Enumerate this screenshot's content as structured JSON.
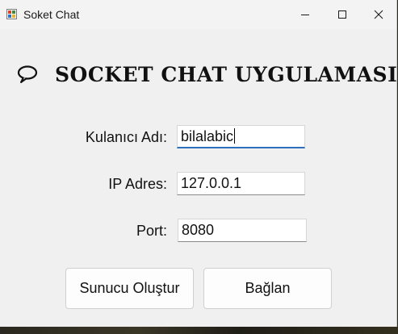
{
  "window": {
    "title": "Soket Chat"
  },
  "heading": {
    "text": "SOCKET CHAT UYGULAMASI",
    "icon": "speech-bubble-icon"
  },
  "form": {
    "username": {
      "label": "Kulanıcı Adı:",
      "value": "bilalabic"
    },
    "ip": {
      "label": "IP Adres:",
      "value": "127.0.0.1"
    },
    "port": {
      "label": "Port:",
      "value": "8080"
    }
  },
  "buttons": {
    "create_server": "Sunucu Oluştur",
    "connect": "Bağlan"
  },
  "colors": {
    "window_bg": "#f0f0f0",
    "focus_accent": "#2b6fbd"
  }
}
